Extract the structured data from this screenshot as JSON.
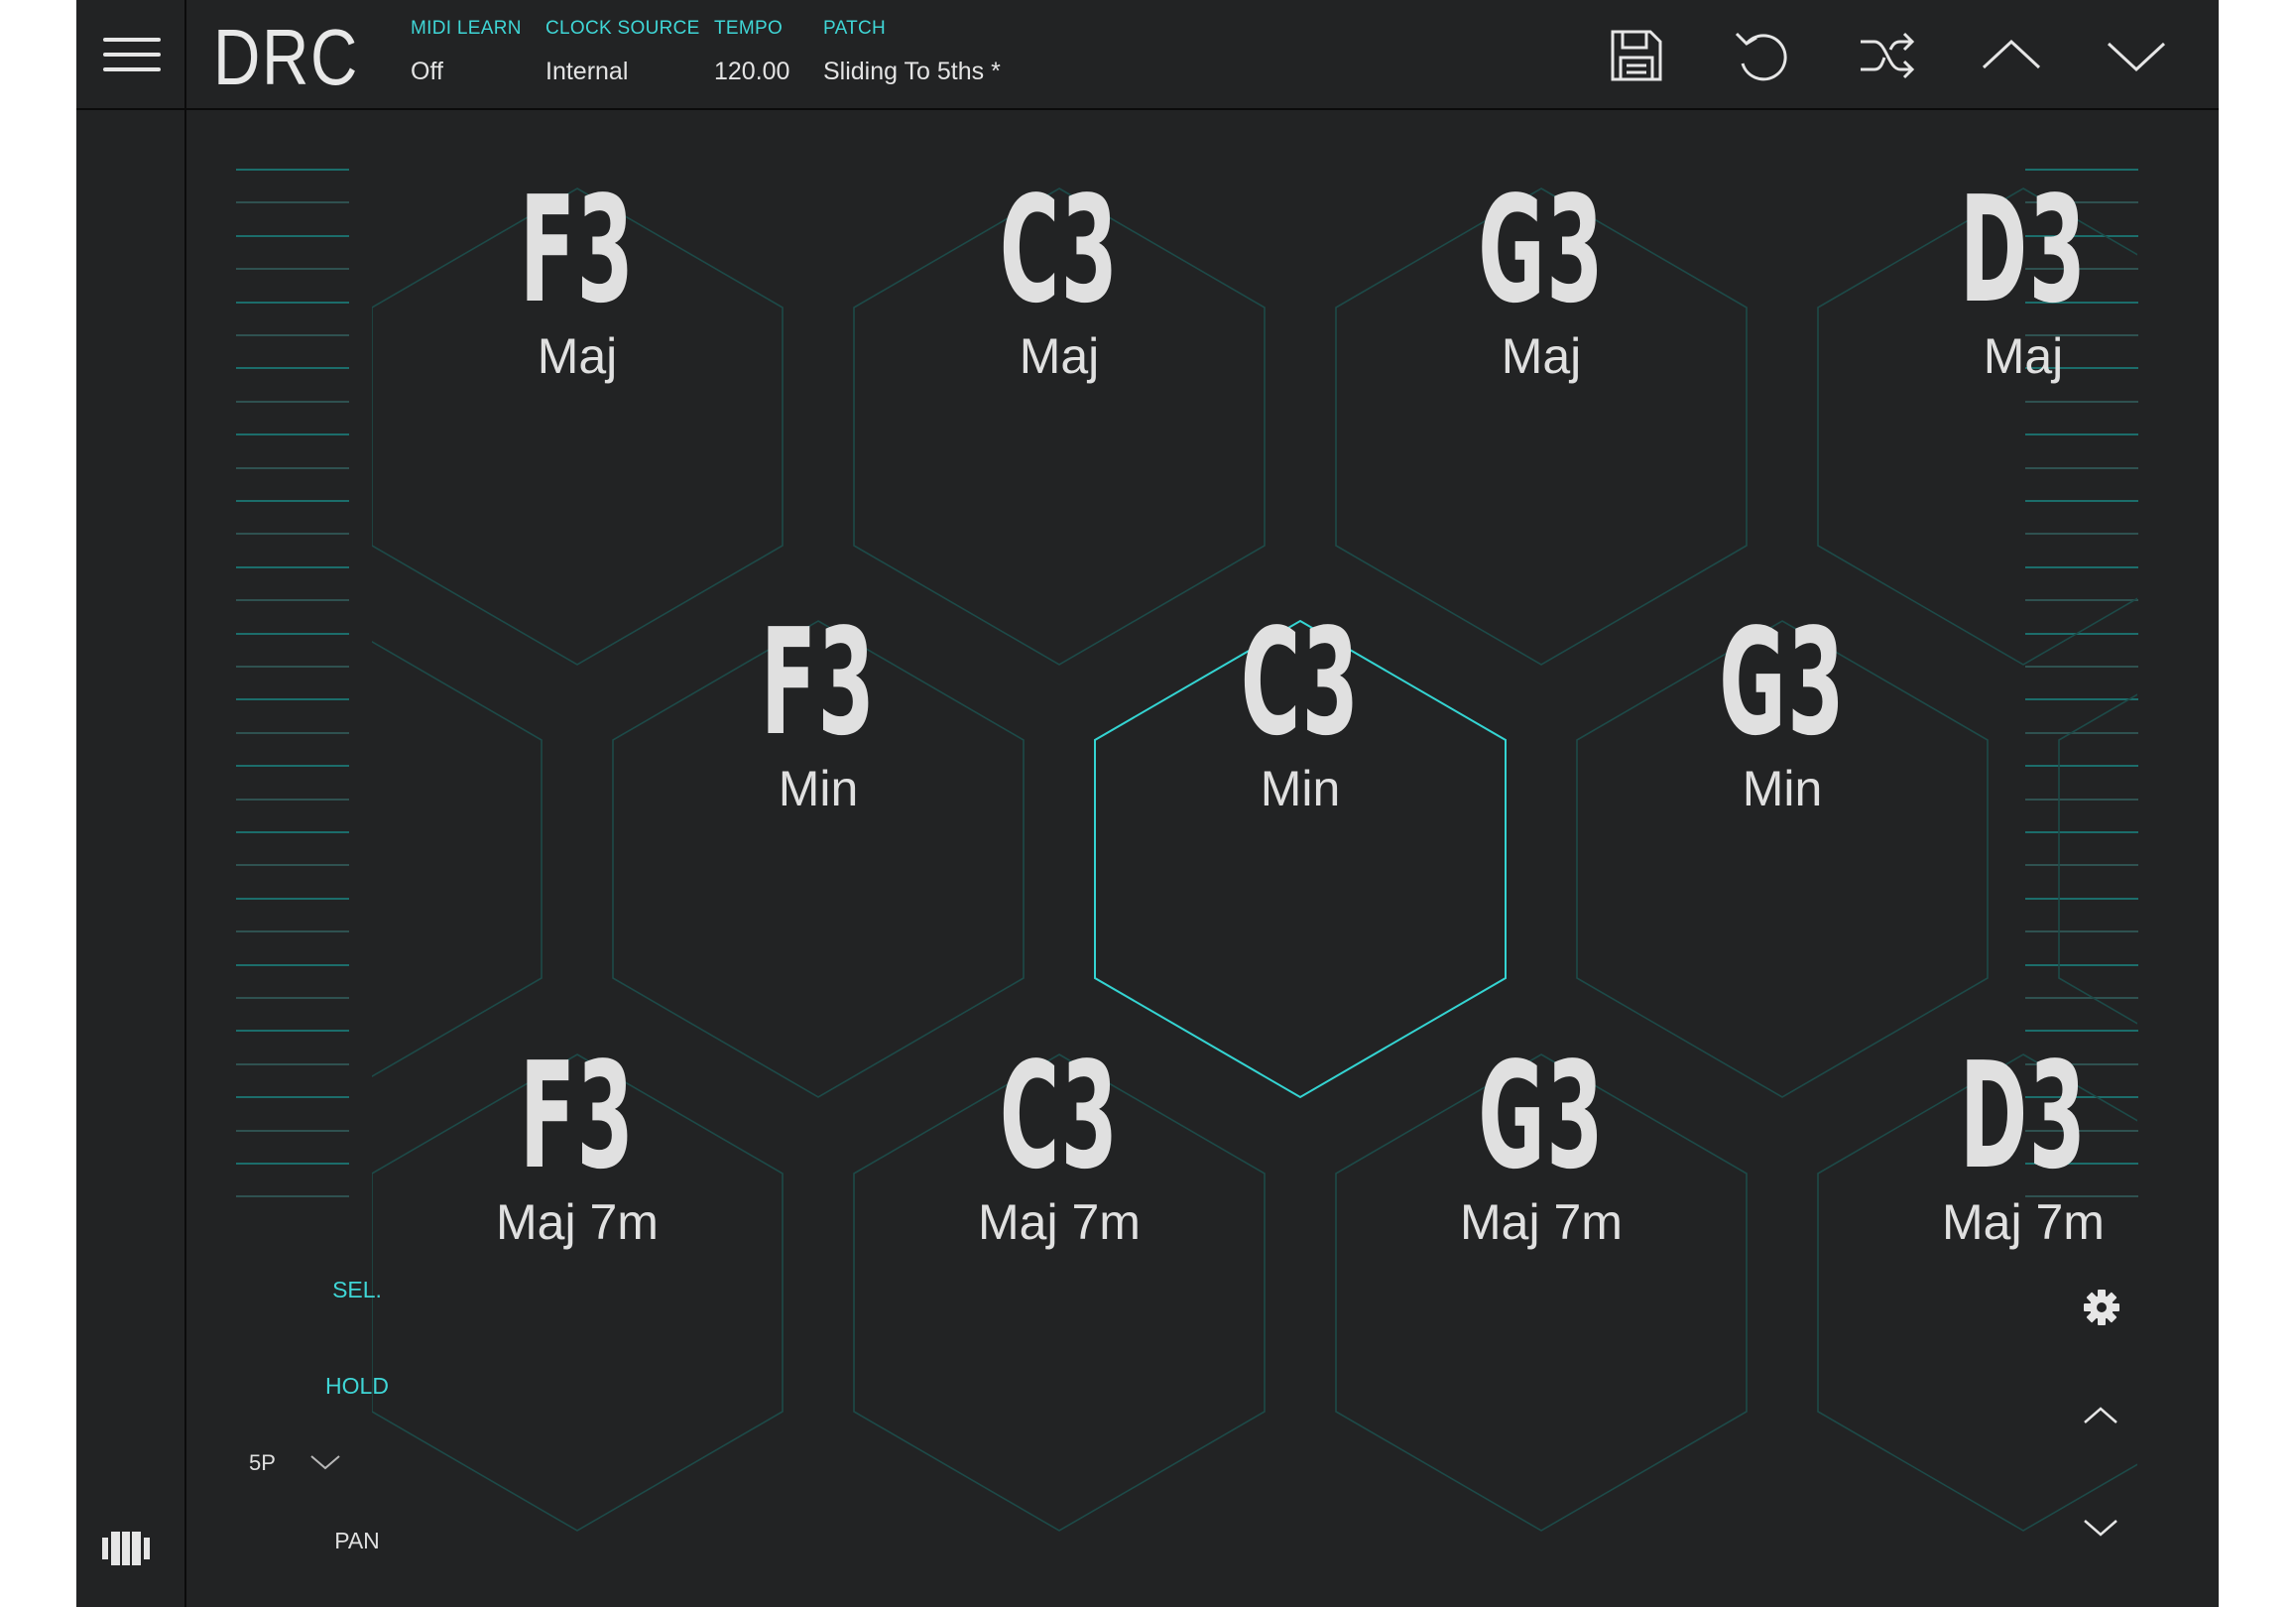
{
  "app": {
    "logo": "DRC"
  },
  "header": {
    "params": [
      {
        "label": "MIDI LEARN",
        "value": "Off"
      },
      {
        "label": "CLOCK SOURCE",
        "value": "Internal"
      },
      {
        "label": "TEMPO",
        "value": "120.00"
      },
      {
        "label": "PATCH",
        "value": "Sliding To 5ths *"
      }
    ],
    "icons": [
      "save-icon",
      "undo-icon",
      "shuffle-icon",
      "chevron-up-icon",
      "chevron-down-icon"
    ]
  },
  "pads": {
    "row1": [
      {
        "note": "F3",
        "quality": "Maj"
      },
      {
        "note": "C3",
        "quality": "Maj"
      },
      {
        "note": "G3",
        "quality": "Maj"
      },
      {
        "note": "D3",
        "quality": "Maj"
      }
    ],
    "row2": [
      {
        "note": "F3",
        "quality": "Min"
      },
      {
        "note": "C3",
        "quality": "Min",
        "selected": true
      },
      {
        "note": "G3",
        "quality": "Min"
      }
    ],
    "row3": [
      {
        "note": "F3",
        "quality": "Maj 7m"
      },
      {
        "note": "C3",
        "quality": "Maj 7m"
      },
      {
        "note": "G3",
        "quality": "Maj 7m"
      },
      {
        "note": "D3",
        "quality": "Maj 7m"
      }
    ]
  },
  "left_controls": {
    "sel": "SEL.",
    "hold": "HOLD",
    "mode": "5P",
    "pan": "PAN"
  },
  "colors": {
    "background": "#222324",
    "accent": "#3fd6d6",
    "hex_outline": "#1d4a48",
    "hex_selected": "#34d4d2",
    "text": "#e0e0e0"
  }
}
